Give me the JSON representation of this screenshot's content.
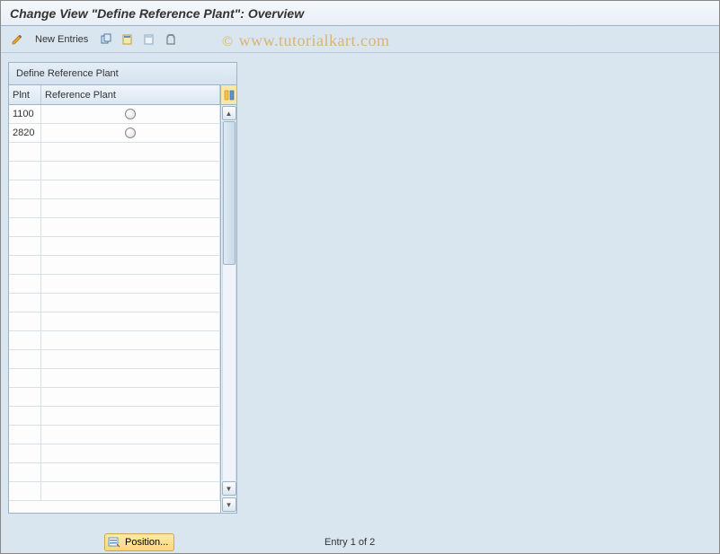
{
  "title": "Change View \"Define Reference Plant\": Overview",
  "watermark": "www.tutorialkart.com",
  "toolbar": {
    "new_entries_label": "New Entries"
  },
  "panel": {
    "header": "Define Reference Plant",
    "columns": {
      "plnt": "Plnt",
      "reference_plant": "Reference Plant"
    },
    "rows": [
      {
        "plnt": "1100",
        "reference_plant": ""
      },
      {
        "plnt": "2820",
        "reference_plant": ""
      }
    ],
    "empty_row_count": 19
  },
  "footer": {
    "position_label": "Position...",
    "entry_info": "Entry 1 of 2"
  },
  "colors": {
    "background": "#d9e5ef",
    "border": "#9db4c8",
    "header_gradient_light": "#f4f8fb",
    "header_gradient_dark": "#e8eff6",
    "position_button": "#f9d97a"
  }
}
